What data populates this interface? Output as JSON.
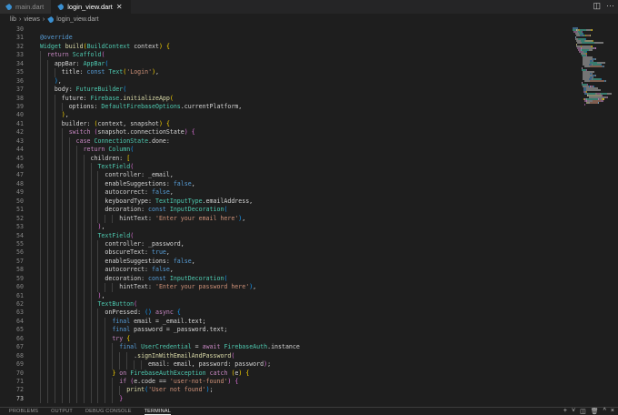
{
  "tabs": [
    {
      "label": "main.dart",
      "active": false
    },
    {
      "label": "login_view.dart",
      "active": true
    }
  ],
  "tab_close": "✕",
  "breadcrumb": [
    "lib",
    "views",
    "login_view.dart"
  ],
  "breadcrumb_sep": "›",
  "editor_icons": {
    "split": "◫",
    "more": "···"
  },
  "panel": {
    "tabs": [
      "PROBLEMS",
      "OUTPUT",
      "DEBUG CONSOLE",
      "TERMINAL"
    ],
    "active": "TERMINAL",
    "icons": [
      "+",
      "˅",
      "◫",
      "🗑",
      "^",
      "×"
    ]
  },
  "colors": {
    "background": "#1e1e1e",
    "keyword": "#c586c0",
    "type": "#4ec9b0",
    "string": "#ce9178",
    "literal": "#569cd6"
  },
  "code": {
    "current_line": 73,
    "lines": [
      {
        "n": 30,
        "i": 0,
        "tk": []
      },
      {
        "n": 31,
        "i": 2,
        "tk": [
          [
            "b",
            "@override"
          ]
        ]
      },
      {
        "n": 32,
        "i": 2,
        "tk": [
          [
            "t",
            "Widget"
          ],
          [
            "p",
            " "
          ],
          [
            "f",
            "build"
          ],
          [
            "y",
            "("
          ],
          [
            "t",
            "BuildContext"
          ],
          [
            "p",
            " context"
          ],
          [
            "y",
            ")"
          ],
          [
            "p",
            " "
          ],
          [
            "y",
            "{"
          ]
        ]
      },
      {
        "n": 33,
        "i": 4,
        "tk": [
          [
            "k",
            "return"
          ],
          [
            "p",
            " "
          ],
          [
            "t",
            "Scaffold"
          ],
          [
            "m",
            "("
          ]
        ]
      },
      {
        "n": 34,
        "i": 6,
        "tk": [
          [
            "p",
            "appBar: "
          ],
          [
            "t",
            "AppBar"
          ],
          [
            "c",
            "("
          ]
        ]
      },
      {
        "n": 35,
        "i": 8,
        "tk": [
          [
            "p",
            "title: "
          ],
          [
            "b",
            "const"
          ],
          [
            "p",
            " "
          ],
          [
            "t",
            "Text"
          ],
          [
            "y",
            "("
          ],
          [
            "s",
            "'Login'"
          ],
          [
            "y",
            ")"
          ],
          [
            "p",
            ","
          ]
        ]
      },
      {
        "n": 36,
        "i": 6,
        "tk": [
          [
            "c",
            ")"
          ],
          [
            "p",
            ","
          ]
        ]
      },
      {
        "n": 37,
        "i": 6,
        "tk": [
          [
            "p",
            "body: "
          ],
          [
            "t",
            "FutureBuilder"
          ],
          [
            "c",
            "("
          ]
        ]
      },
      {
        "n": 38,
        "i": 8,
        "tk": [
          [
            "p",
            "future: "
          ],
          [
            "t",
            "Firebase"
          ],
          [
            "p",
            "."
          ],
          [
            "f",
            "initializeApp"
          ],
          [
            "y",
            "("
          ]
        ]
      },
      {
        "n": 39,
        "i": 10,
        "tk": [
          [
            "p",
            "options: "
          ],
          [
            "t",
            "DefaultFirebaseOptions"
          ],
          [
            "p",
            ".currentPlatform,"
          ]
        ]
      },
      {
        "n": 40,
        "i": 8,
        "tk": [
          [
            "y",
            ")"
          ],
          [
            "p",
            ","
          ]
        ]
      },
      {
        "n": 41,
        "i": 8,
        "tk": [
          [
            "p",
            "builder: "
          ],
          [
            "y",
            "("
          ],
          [
            "p",
            "context, snapshot"
          ],
          [
            "y",
            ")"
          ],
          [
            "p",
            " "
          ],
          [
            "y",
            "{"
          ]
        ]
      },
      {
        "n": 42,
        "i": 10,
        "tk": [
          [
            "k",
            "switch"
          ],
          [
            "p",
            " "
          ],
          [
            "m",
            "("
          ],
          [
            "p",
            "snapshot.connectionState"
          ],
          [
            "m",
            ")"
          ],
          [
            "p",
            " "
          ],
          [
            "m",
            "{"
          ]
        ]
      },
      {
        "n": 43,
        "i": 12,
        "tk": [
          [
            "k",
            "case"
          ],
          [
            "p",
            " "
          ],
          [
            "t",
            "ConnectionState"
          ],
          [
            "p",
            ".done:"
          ]
        ]
      },
      {
        "n": 44,
        "i": 14,
        "tk": [
          [
            "k",
            "return"
          ],
          [
            "p",
            " "
          ],
          [
            "t",
            "Column"
          ],
          [
            "c",
            "("
          ]
        ]
      },
      {
        "n": 45,
        "i": 16,
        "tk": [
          [
            "p",
            "children: "
          ],
          [
            "y",
            "["
          ]
        ]
      },
      {
        "n": 46,
        "i": 18,
        "tk": [
          [
            "t",
            "TextField"
          ],
          [
            "m",
            "("
          ]
        ]
      },
      {
        "n": 47,
        "i": 20,
        "tk": [
          [
            "p",
            "controller: _email,"
          ]
        ]
      },
      {
        "n": 48,
        "i": 20,
        "tk": [
          [
            "p",
            "enableSuggestions: "
          ],
          [
            "b",
            "false"
          ],
          [
            "p",
            ","
          ]
        ]
      },
      {
        "n": 49,
        "i": 20,
        "tk": [
          [
            "p",
            "autocorrect: "
          ],
          [
            "b",
            "false"
          ],
          [
            "p",
            ","
          ]
        ]
      },
      {
        "n": 50,
        "i": 20,
        "tk": [
          [
            "p",
            "keyboardType: "
          ],
          [
            "t",
            "TextInputType"
          ],
          [
            "p",
            ".emailAddress,"
          ]
        ]
      },
      {
        "n": 51,
        "i": 20,
        "tk": [
          [
            "p",
            "decoration: "
          ],
          [
            "b",
            "const"
          ],
          [
            "p",
            " "
          ],
          [
            "t",
            "InputDecoration"
          ],
          [
            "c",
            "("
          ]
        ]
      },
      {
        "n": 52,
        "i": 24,
        "tk": [
          [
            "p",
            "hintText: "
          ],
          [
            "s",
            "'Enter your email here'"
          ],
          [
            "c",
            ")"
          ],
          [
            "p",
            ","
          ]
        ]
      },
      {
        "n": 53,
        "i": 18,
        "tk": [
          [
            "m",
            ")"
          ],
          [
            "p",
            ","
          ]
        ]
      },
      {
        "n": 54,
        "i": 18,
        "tk": [
          [
            "t",
            "TextField"
          ],
          [
            "m",
            "("
          ]
        ]
      },
      {
        "n": 55,
        "i": 20,
        "tk": [
          [
            "p",
            "controller: _password,"
          ]
        ]
      },
      {
        "n": 56,
        "i": 20,
        "tk": [
          [
            "p",
            "obscureText: "
          ],
          [
            "b",
            "true"
          ],
          [
            "p",
            ","
          ]
        ]
      },
      {
        "n": 57,
        "i": 20,
        "tk": [
          [
            "p",
            "enableSuggestions: "
          ],
          [
            "b",
            "false"
          ],
          [
            "p",
            ","
          ]
        ]
      },
      {
        "n": 58,
        "i": 20,
        "tk": [
          [
            "p",
            "autocorrect: "
          ],
          [
            "b",
            "false"
          ],
          [
            "p",
            ","
          ]
        ]
      },
      {
        "n": 59,
        "i": 20,
        "tk": [
          [
            "p",
            "decoration: "
          ],
          [
            "b",
            "const"
          ],
          [
            "p",
            " "
          ],
          [
            "t",
            "InputDecoration"
          ],
          [
            "c",
            "("
          ]
        ]
      },
      {
        "n": 60,
        "i": 24,
        "tk": [
          [
            "p",
            "hintText: "
          ],
          [
            "s",
            "'Enter your password here'"
          ],
          [
            "c",
            ")"
          ],
          [
            "p",
            ","
          ]
        ]
      },
      {
        "n": 61,
        "i": 18,
        "tk": [
          [
            "m",
            ")"
          ],
          [
            "p",
            ","
          ]
        ]
      },
      {
        "n": 62,
        "i": 18,
        "tk": [
          [
            "t",
            "TextButton"
          ],
          [
            "m",
            "("
          ]
        ]
      },
      {
        "n": 63,
        "i": 20,
        "tk": [
          [
            "p",
            "onPressed: "
          ],
          [
            "c",
            "()"
          ],
          [
            "p",
            " "
          ],
          [
            "k",
            "async"
          ],
          [
            "p",
            " "
          ],
          [
            "c",
            "{"
          ]
        ]
      },
      {
        "n": 64,
        "i": 22,
        "tk": [
          [
            "b",
            "final"
          ],
          [
            "p",
            " email = _email.text;"
          ]
        ]
      },
      {
        "n": 65,
        "i": 22,
        "tk": [
          [
            "b",
            "final"
          ],
          [
            "p",
            " password = _password.text;"
          ]
        ]
      },
      {
        "n": 66,
        "i": 22,
        "tk": [
          [
            "k",
            "try"
          ],
          [
            "p",
            " "
          ],
          [
            "y",
            "{"
          ]
        ]
      },
      {
        "n": 67,
        "i": 24,
        "tk": [
          [
            "b",
            "final"
          ],
          [
            "p",
            " "
          ],
          [
            "t",
            "UserCredential"
          ],
          [
            "p",
            " = "
          ],
          [
            "k",
            "await"
          ],
          [
            "p",
            " "
          ],
          [
            "t",
            "FirebaseAuth"
          ],
          [
            "p",
            ".instance"
          ]
        ]
      },
      {
        "n": 68,
        "i": 28,
        "tk": [
          [
            "p",
            "."
          ],
          [
            "f",
            "signInWithEmailAndPassword"
          ],
          [
            "m",
            "("
          ]
        ]
      },
      {
        "n": 69,
        "i": 32,
        "tk": [
          [
            "p",
            "email: email, password: password"
          ],
          [
            "m",
            ")"
          ],
          [
            "p",
            ";"
          ]
        ]
      },
      {
        "n": 70,
        "i": 22,
        "tk": [
          [
            "y",
            "}"
          ],
          [
            "p",
            " "
          ],
          [
            "k",
            "on"
          ],
          [
            "p",
            " "
          ],
          [
            "t",
            "FirebaseAuthException"
          ],
          [
            "p",
            " "
          ],
          [
            "k",
            "catch"
          ],
          [
            "p",
            " "
          ],
          [
            "y",
            "("
          ],
          [
            "p",
            "e"
          ],
          [
            "y",
            ")"
          ],
          [
            "p",
            " "
          ],
          [
            "y",
            "{"
          ]
        ]
      },
      {
        "n": 71,
        "i": 24,
        "tk": [
          [
            "k",
            "if"
          ],
          [
            "p",
            " "
          ],
          [
            "m",
            "("
          ],
          [
            "p",
            "e.code == "
          ],
          [
            "s",
            "'user-not-found'"
          ],
          [
            "m",
            ")"
          ],
          [
            "p",
            " "
          ],
          [
            "m",
            "{"
          ]
        ]
      },
      {
        "n": 72,
        "i": 26,
        "tk": [
          [
            "f",
            "print"
          ],
          [
            "c",
            "("
          ],
          [
            "s",
            "'User not found'"
          ],
          [
            "c",
            ")"
          ],
          [
            "p",
            ";"
          ]
        ]
      },
      {
        "n": 73,
        "i": 24,
        "tk": [
          [
            "m",
            "}"
          ]
        ]
      }
    ]
  }
}
